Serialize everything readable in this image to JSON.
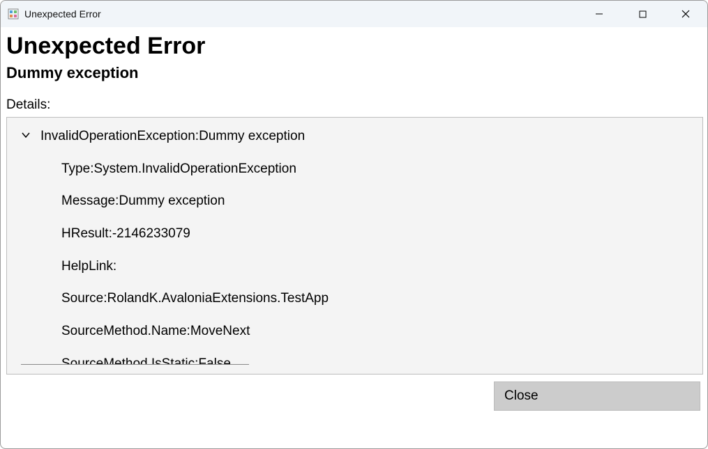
{
  "window": {
    "title": "Unexpected Error"
  },
  "heading": "Unexpected Error",
  "subheading": "Dummy exception",
  "details_label": "Details:",
  "exception": {
    "summary": "InvalidOperationException:Dummy exception",
    "rows": [
      "Type:System.InvalidOperationException",
      "Message:Dummy exception",
      "HResult:-2146233079",
      "HelpLink:",
      "Source:RolandK.AvaloniaExtensions.TestApp",
      "SourceMethod.Name:MoveNext",
      "SourceMethod.IsStatic:False"
    ]
  },
  "buttons": {
    "close": "Close"
  }
}
